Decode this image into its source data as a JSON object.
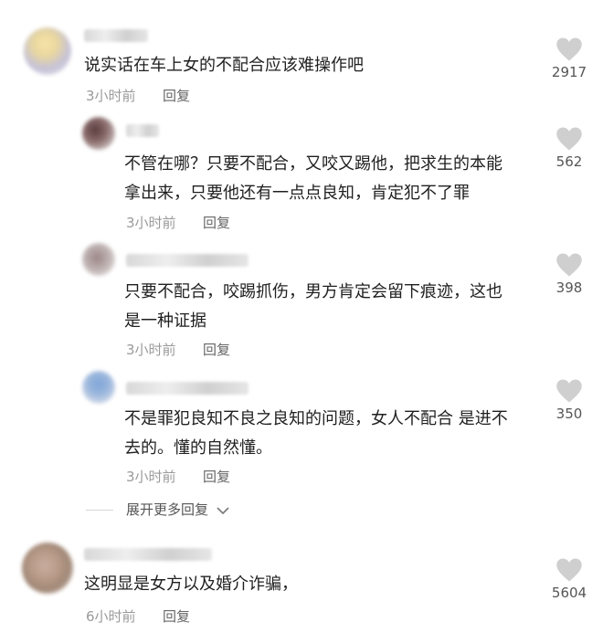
{
  "colors": {
    "heart": "#cfcfcf",
    "meta": "#9a9a9a",
    "text": "#1f1f1f"
  },
  "comments": [
    {
      "text": "说实话在车上女的不配合应该难操作吧",
      "time": "3小时前",
      "reply": "回复",
      "likes": "2917"
    },
    {
      "text_line1": "不管在哪？只要不配合，又咬又踢他，把求生的本能",
      "text_line2": "拿出来，只要他还有一点点良知，肯定犯不了罪",
      "time": "3小时前",
      "reply": "回复",
      "likes": "562"
    },
    {
      "text_line1": "只要不配合，咬踢抓伤，男方肯定会留下痕迹，这也",
      "text_line2": "是一种证据",
      "time": "3小时前",
      "reply": "回复",
      "likes": "398"
    },
    {
      "text_line1": "不是罪犯良知不良之良知的问题，女人不配合 是进不",
      "text_line2": "去的。懂的自然懂。",
      "time": "3小时前",
      "reply": "回复",
      "likes": "350"
    },
    {
      "text": "这明显是女方以及婚介诈骗，",
      "time": "6小时前",
      "reply": "回复",
      "likes": "5604"
    }
  ],
  "expand": {
    "label": "展开更多回复"
  }
}
